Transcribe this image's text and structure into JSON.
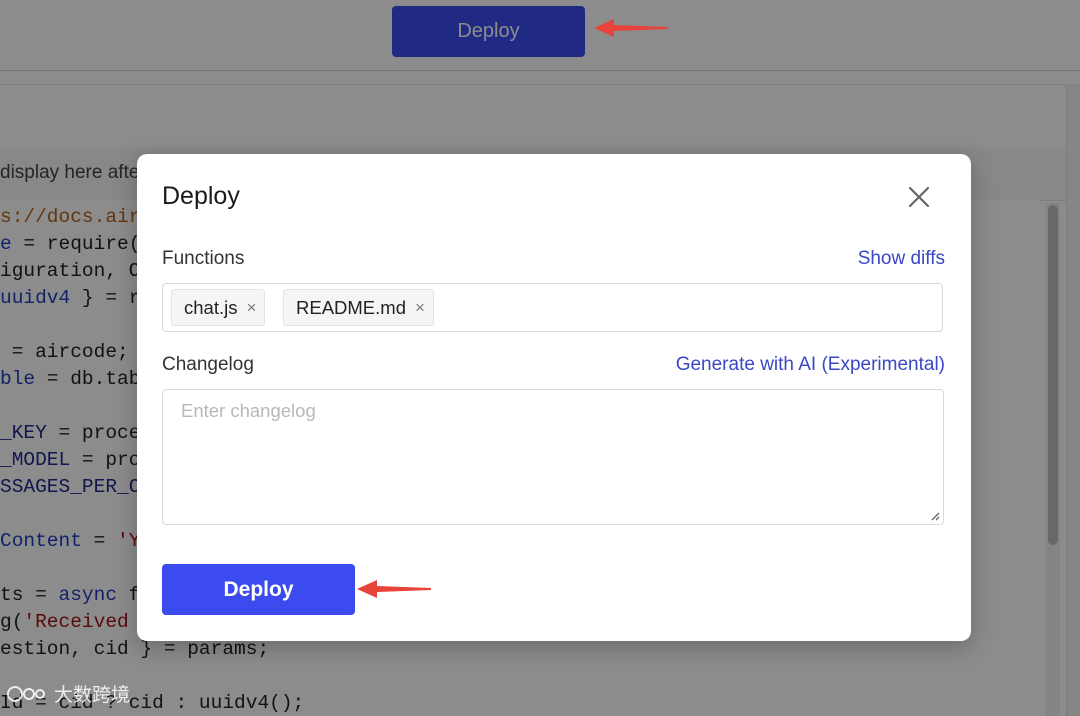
{
  "topbar": {
    "deploy_label": "Deploy"
  },
  "hint": {
    "text": "display here afte"
  },
  "code_lines": [
    {
      "parts": [
        {
          "t": "s://docs.air",
          "c": "c-url"
        }
      ]
    },
    {
      "parts": [
        {
          "t": "e",
          "c": "c-blue"
        },
        {
          "t": " = require(",
          "c": ""
        }
      ]
    },
    {
      "parts": [
        {
          "t": "iguration, O",
          "c": ""
        }
      ]
    },
    {
      "parts": [
        {
          "t": "uuidv4",
          "c": "c-blue"
        },
        {
          "t": " } = r",
          "c": ""
        }
      ]
    },
    {
      "parts": [
        {
          "t": "",
          "c": ""
        }
      ]
    },
    {
      "parts": [
        {
          "t": " = aircode;",
          "c": ""
        }
      ]
    },
    {
      "parts": [
        {
          "t": "ble",
          "c": "c-blue"
        },
        {
          "t": " = db.tab",
          "c": ""
        }
      ]
    },
    {
      "parts": [
        {
          "t": "",
          "c": ""
        }
      ]
    },
    {
      "parts": [
        {
          "t": "_KEY",
          "c": "c-dark"
        },
        {
          "t": " = proce",
          "c": ""
        }
      ]
    },
    {
      "parts": [
        {
          "t": "_MODEL",
          "c": "c-dark"
        },
        {
          "t": " = pro",
          "c": ""
        }
      ]
    },
    {
      "parts": [
        {
          "t": "SSAGES_PER_C",
          "c": "c-dark"
        }
      ]
    },
    {
      "parts": [
        {
          "t": "",
          "c": ""
        }
      ]
    },
    {
      "parts": [
        {
          "t": "Content",
          "c": "c-blue"
        },
        {
          "t": " = ",
          "c": ""
        },
        {
          "t": "'Y",
          "c": "c-str"
        }
      ]
    },
    {
      "parts": [
        {
          "t": "",
          "c": ""
        }
      ]
    },
    {
      "parts": [
        {
          "t": "ts = ",
          "c": ""
        },
        {
          "t": "async",
          "c": "c-blue"
        },
        {
          "t": " f",
          "c": ""
        }
      ]
    },
    {
      "parts": [
        {
          "t": "g(",
          "c": ""
        },
        {
          "t": "'Received",
          "c": "c-str"
        }
      ]
    },
    {
      "parts": [
        {
          "t": "estion, cid } = params;",
          "c": ""
        }
      ]
    },
    {
      "parts": [
        {
          "t": "",
          "c": ""
        }
      ]
    },
    {
      "parts": [
        {
          "t": "Id = cid ? cid : uuidv4();",
          "c": ""
        }
      ]
    }
  ],
  "modal": {
    "title": "Deploy",
    "functions_label": "Functions",
    "show_diffs_label": "Show diffs",
    "tags": [
      {
        "label": "chat.js"
      },
      {
        "label": "README.md"
      }
    ],
    "tag_remove_glyph": "×",
    "changelog_label": "Changelog",
    "generate_ai_label": "Generate with AI (Experimental)",
    "changelog_placeholder": "Enter changelog",
    "changelog_value": "",
    "deploy_label": "Deploy"
  },
  "watermark": {
    "text": "大数跨境"
  },
  "colors": {
    "primary": "#3b4bf0",
    "link": "#3a47c6",
    "annotation_arrow": "#e8433a"
  },
  "icons": {
    "close": "close-icon",
    "tag_remove": "x-icon",
    "resize": "resize-grip-icon",
    "annotation": "red-arrow-icon"
  }
}
